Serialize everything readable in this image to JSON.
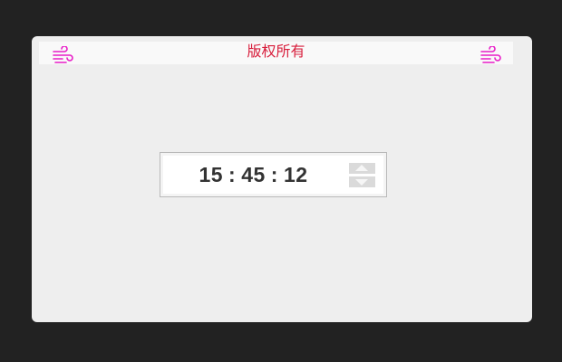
{
  "header": {
    "title": "版权所有",
    "left_icon": "wind-icon",
    "right_icon": "wind-icon",
    "icon_color": "#e81ec8",
    "title_color": "#d81e3c"
  },
  "time_picker": {
    "hours": "15",
    "minutes": "45",
    "seconds": "12",
    "separator": ":",
    "increment_icon": "triangle-up-icon",
    "decrement_icon": "triangle-down-icon"
  },
  "colors": {
    "background": "#222222",
    "card": "#eeeeee",
    "text": "#333333"
  }
}
